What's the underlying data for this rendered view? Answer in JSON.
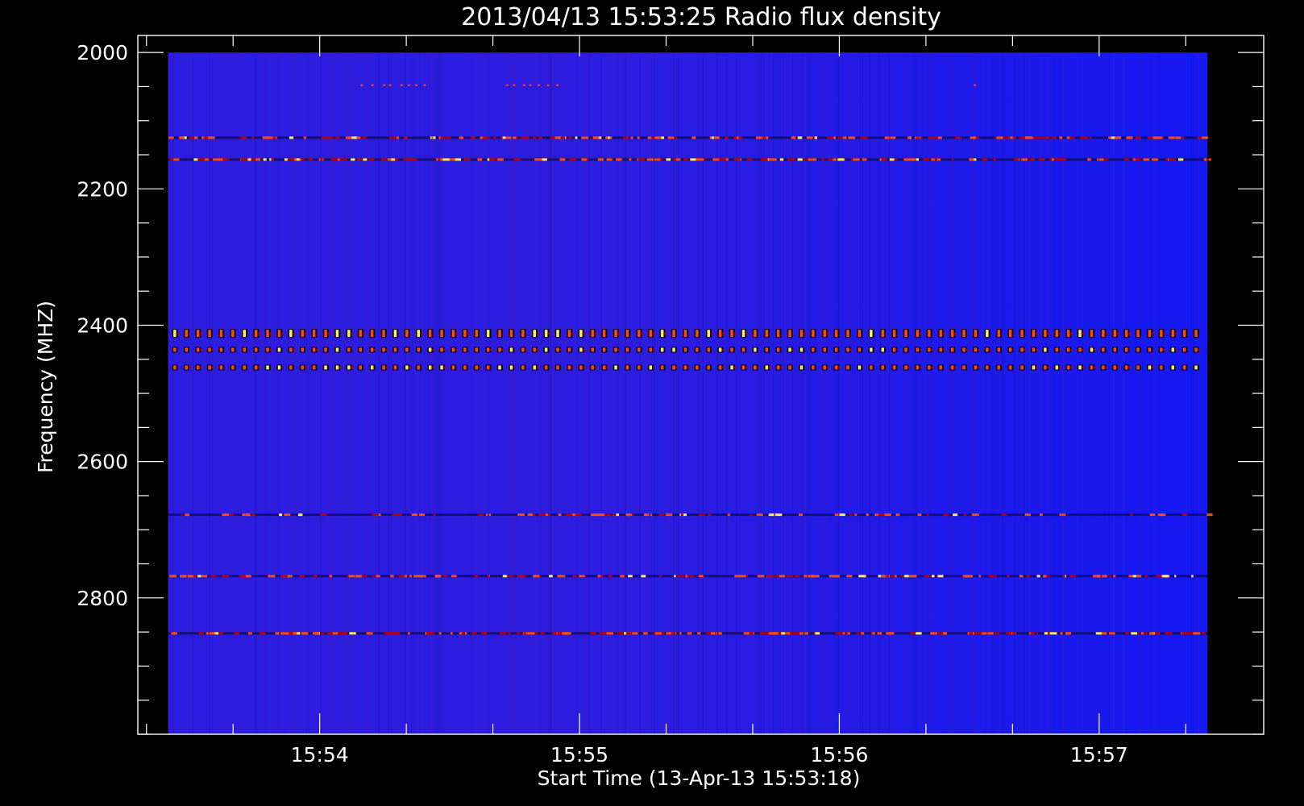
{
  "chart_data": {
    "type": "heatmap",
    "title": "2013/04/13 15:53:25 Radio flux density",
    "xlabel": "Start Time (13-Apr-13 15:53:18)",
    "ylabel": "Frequency (MHZ)",
    "x_time_range": [
      "15:53:18",
      "15:57:38"
    ],
    "x_major_ticks": [
      "15:54",
      "15:55",
      "15:56",
      "15:57"
    ],
    "x_minor_step_seconds": 20,
    "ylim": [
      1975,
      3000
    ],
    "y_inverted": true,
    "y_major_ticks": [
      2000,
      2200,
      2400,
      2600,
      2800
    ],
    "y_minor_step": 50,
    "image_extent": {
      "time": [
        "15:53:25",
        "15:57:25"
      ],
      "freq": [
        2000,
        3000
      ]
    },
    "colors": {
      "background": "#000000",
      "axes": "#ffffff",
      "field": "#2c1ce0",
      "field_right": "#1418f2",
      "emission_low": "#b00010",
      "emission_mid": "#ff4a10",
      "emission_high": "#ffee60",
      "dark": "#05051a"
    },
    "emission_bands": [
      {
        "freq": 2048,
        "intensity": 0.5,
        "kind": "sparse"
      },
      {
        "freq": 2125,
        "intensity": 0.75,
        "kind": "continuous"
      },
      {
        "freq": 2157,
        "intensity": 0.8,
        "kind": "continuous"
      },
      {
        "freq": 2412,
        "intensity": 1.0,
        "kind": "periodic"
      },
      {
        "freq": 2436,
        "intensity": 0.85,
        "kind": "periodic"
      },
      {
        "freq": 2462,
        "intensity": 0.8,
        "kind": "periodic"
      },
      {
        "freq": 2678,
        "intensity": 0.4,
        "kind": "continuous"
      },
      {
        "freq": 2768,
        "intensity": 0.7,
        "kind": "continuous"
      },
      {
        "freq": 2852,
        "intensity": 0.75,
        "kind": "continuous"
      }
    ]
  }
}
